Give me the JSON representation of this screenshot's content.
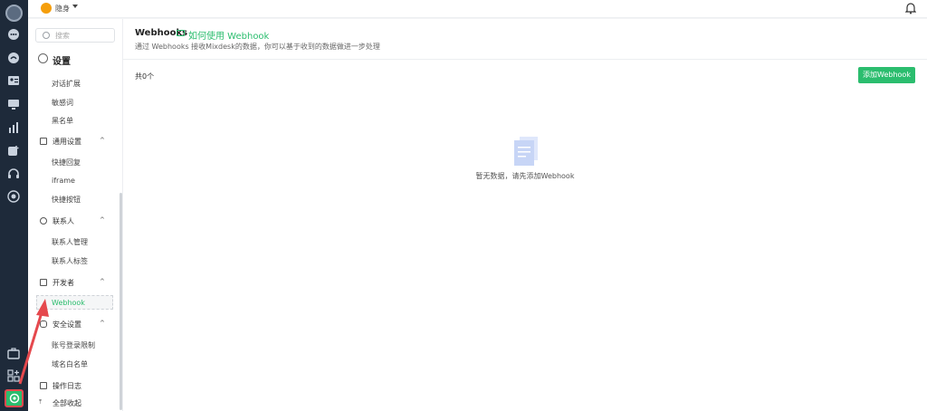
{
  "topbar": {
    "status_text": "隐身"
  },
  "sidebar": {
    "search_placeholder": "搜索",
    "title": "设置",
    "items_top": [
      "对话扩展",
      "敏感词",
      "黑名单"
    ],
    "group_general": {
      "label": "通用设置",
      "items": [
        "快捷回复",
        "iframe",
        "快捷按钮"
      ]
    },
    "group_contacts": {
      "label": "联系人",
      "items": [
        "联系人管理",
        "联系人标签"
      ]
    },
    "group_dev": {
      "label": "开发者",
      "items": [
        "Webhook"
      ]
    },
    "group_security": {
      "label": "安全设置",
      "items": [
        "账号登录限制",
        "域名白名单"
      ]
    },
    "op_log": "操作日志",
    "collapse_all": "全部收起"
  },
  "main": {
    "title": "Webhooks",
    "help_link": "如何使用 Webhook",
    "description": "通过 Webhooks 接收Mixdesk的数据，你可以基于收到的数据做进一步处理",
    "count": "共0个",
    "add_button": "添加Webhook",
    "empty_text": "暂无数据，请先添加Webhook"
  },
  "colors": {
    "accent": "#2bbd6e",
    "rail": "#1e2a3a",
    "annotation": "#e5484d"
  }
}
